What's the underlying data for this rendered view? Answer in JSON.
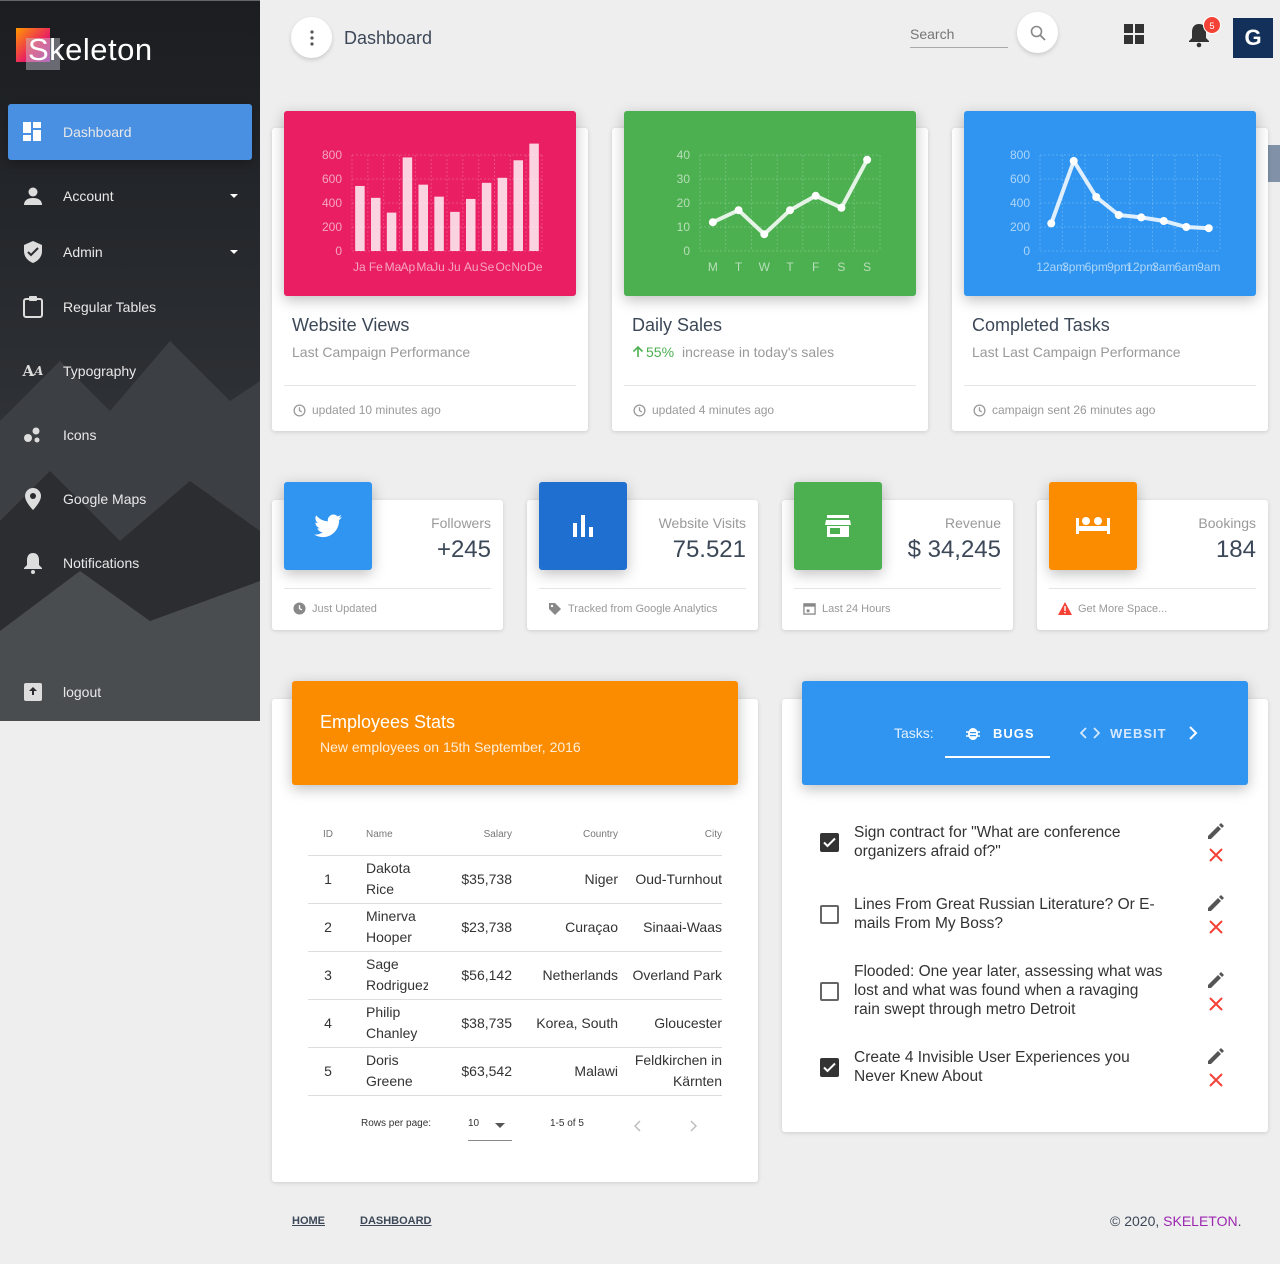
{
  "brand": {
    "name": "Skeleton"
  },
  "sidebar": {
    "items": [
      {
        "label": "Dashboard",
        "icon": "dashboard-icon"
      },
      {
        "label": "Account",
        "icon": "person-icon"
      },
      {
        "label": "Admin",
        "icon": "shield-icon"
      },
      {
        "label": "Regular Tables",
        "icon": "clipboard-icon"
      },
      {
        "label": "Typography",
        "icon": "typography-icon"
      },
      {
        "label": "Icons",
        "icon": "bubbles-icon"
      },
      {
        "label": "Google Maps",
        "icon": "location-pin-icon"
      },
      {
        "label": "Notifications",
        "icon": "bell-icon"
      },
      {
        "label": "logout",
        "icon": "logout-icon"
      }
    ]
  },
  "header": {
    "title": "Dashboard",
    "search_placeholder": "Search",
    "notif_count": "5",
    "avatar_letter": "G"
  },
  "cards": [
    {
      "title": "Website Views",
      "sub": "Last Campaign Performance",
      "foot": "updated 10 minutes ago",
      "color": "#e91e63"
    },
    {
      "title": "Daily Sales",
      "sub_pct": "55%",
      "sub": "increase in today's sales",
      "foot": "updated 4 minutes ago",
      "color": "#4caf50"
    },
    {
      "title": "Completed Tasks",
      "sub": "Last Last Campaign Performance",
      "foot": "campaign sent 26 minutes ago",
      "color": "#2f95f0"
    }
  ],
  "chart_data": [
    {
      "type": "bar",
      "categories": [
        "Ja",
        "Fe",
        "Ma",
        "Ap",
        "Ma",
        "Ju",
        "Ju",
        "Au",
        "Se",
        "Oc",
        "No",
        "De"
      ],
      "values": [
        542,
        443,
        320,
        780,
        553,
        453,
        326,
        434,
        568,
        610,
        756,
        895
      ],
      "ylim": [
        0,
        800
      ],
      "yticks": [
        "800",
        "600",
        "400",
        "200",
        "0"
      ]
    },
    {
      "type": "line",
      "categories": [
        "M",
        "T",
        "W",
        "T",
        "F",
        "S",
        "S"
      ],
      "values": [
        12,
        17,
        7,
        17,
        23,
        18,
        38
      ],
      "ylim": [
        0,
        40
      ],
      "yticks": [
        "40",
        "30",
        "20",
        "10",
        "0"
      ]
    },
    {
      "type": "line",
      "categories": [
        "12am",
        "3pm",
        "6pm",
        "9pm",
        "12pm",
        "3am",
        "6am",
        "9am"
      ],
      "values": [
        230,
        750,
        450,
        300,
        280,
        250,
        200,
        190
      ],
      "ylim": [
        0,
        800
      ],
      "yticks": [
        "800",
        "600",
        "400",
        "200",
        "0"
      ]
    }
  ],
  "stats": [
    {
      "category": "Followers",
      "value": "+245",
      "foot": "Just Updated",
      "color": "#2f95f0",
      "icon": "twitter-icon"
    },
    {
      "category": "Website Visits",
      "value": "75.521",
      "foot": "Tracked from Google Analytics",
      "color": "#1e6fd0",
      "icon": "bar-chart-icon"
    },
    {
      "category": "Revenue",
      "value": "$ 34,245",
      "foot": "Last 24 Hours",
      "color": "#4caf50",
      "icon": "store-icon"
    },
    {
      "category": "Bookings",
      "value": "184",
      "foot": "Get More Space...",
      "color": "#fb8c00",
      "icon": "bed-icon"
    }
  ],
  "employees": {
    "title": "Employees Stats",
    "subtitle": "New employees on 15th September, 2016",
    "columns": [
      "ID",
      "Name",
      "Salary",
      "Country",
      "City"
    ],
    "rows": [
      [
        "1",
        "Dakota Rice",
        "$35,738",
        "Niger",
        "Oud-Turnhout"
      ],
      [
        "2",
        "Minerva Hooper",
        "$23,738",
        "Curaçao",
        "Sinaai-Waas"
      ],
      [
        "3",
        "Sage Rodriguez",
        "$56,142",
        "Netherlands",
        "Overland Park"
      ],
      [
        "4",
        "Philip Chanley",
        "$38,735",
        "Korea, South",
        "Gloucester"
      ],
      [
        "5",
        "Doris Greene",
        "$63,542",
        "Malawi",
        "Feldkirchen in Kärnten"
      ]
    ],
    "rows_per_page_label": "Rows per page:",
    "rows_per_page": "10",
    "range": "1-5 of 5"
  },
  "tasks": {
    "label": "Tasks:",
    "tab_bugs": "BUGS",
    "tab_website": "WEBSIT",
    "items": [
      {
        "text": "Sign contract for \"What are conference organizers afraid of?\"",
        "checked": true
      },
      {
        "text": "Lines From Great Russian Literature? Or E-mails From My Boss?",
        "checked": false
      },
      {
        "text": "Flooded: One year later, assessing what was lost and what was found when a ravaging rain swept through metro Detroit",
        "checked": false
      },
      {
        "text": "Create 4 Invisible User Experiences you Never Knew About",
        "checked": true
      }
    ]
  },
  "footer": {
    "home": "HOME",
    "dashboard": "DASHBOARD",
    "copyright": "© 2020,",
    "brand_link": "SKELETON",
    "period": "."
  }
}
